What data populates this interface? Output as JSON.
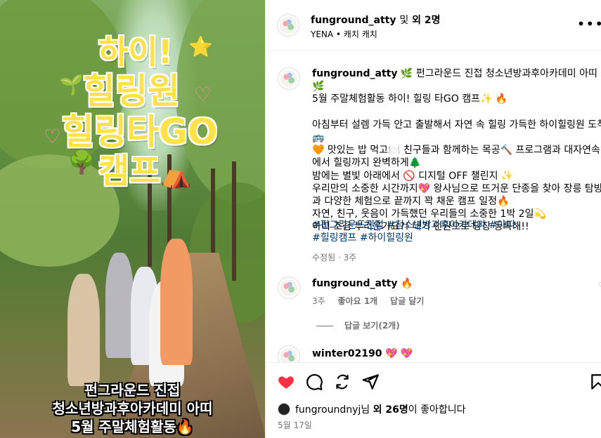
{
  "media": {
    "sticker_lines": [
      "하이!",
      "힐링원",
      "힐링타GO",
      "캠프"
    ],
    "caption_lines": [
      "펀그라운드 진접",
      "청소년방과후아카데미 아띠",
      "5월 주말체험활동🔥"
    ]
  },
  "header": {
    "username": "funground_atty",
    "and": "및",
    "others": "외 2명",
    "audio": "YENA • 캐치 캐치",
    "more_icon": "more-horizontal-icon"
  },
  "caption": {
    "username": "funground_atty",
    "text": " 🌿 펀그라운드 진접 청소년방과후아카데미 아띠 🌿\n5월 주말체험활동 하이! 힐링 타GO 캠프✨ 🔥\n\n아침부터 설렘 가득 안고 출발해서 자연 속 힐링 가득한 하이힐링원 도착🚌\n🧡 맛있는 밥 먹고🍽️ 친구들과 함께하는 목공🔨 프로그램과 대자연속\n에서 힐링까지 완벽하게🌲\n밤에는 별빛 아래에서 🚫 디지털 OFF 챌린지 ✨\n우리만의 소중한 시간까지💖 왕사님으로 뜨거운 단종을 찾아 장릉 탐방\n과 다양한 체험으로 끝까지 꽉 채운 캠프 일정🔥\n자연, 친구, 웃음이 가득했던 우리들의 소중한 1박 2일💫\n아띠 조금 부러운가요?! 대기 인원으로 당장 등록해!!",
    "tags": [
      "#펀그라운드진접",
      "#청소년방과후아카데미",
      "#아띠",
      "#힐링캠프",
      "#하이힐링원"
    ],
    "edited": "수정됨 · 3주"
  },
  "comments": [
    {
      "username": "funground_atty",
      "text": "🔥",
      "age": "3주",
      "likes": "좋아요 1개",
      "reply": "답글 달기",
      "view_replies": "답글 보기(2개)"
    },
    {
      "username": "winter02190",
      "text": "💖 💖"
    }
  ],
  "actions": {
    "icons": [
      "heart-icon",
      "comment-icon",
      "share-icon",
      "send-icon",
      "bookmark-icon"
    ],
    "like_color": "#ff3040",
    "liked_by": "fungroundnyj",
    "liked_by_suffix": "님",
    "others_count": "외 26명",
    "likes_suffix": "이 좋아합니다",
    "date": "5월 17일"
  }
}
